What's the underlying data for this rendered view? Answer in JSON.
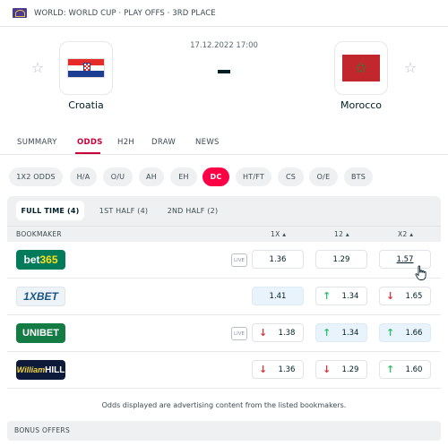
{
  "header": {
    "title": "WORLD: WORLD CUP · PLAY OFFS · 3RD PLACE"
  },
  "match": {
    "datetime": "17.12.2022 17:00",
    "score": "-",
    "home": {
      "name": "Croatia"
    },
    "away": {
      "name": "Morocco"
    }
  },
  "icons": {
    "favorite": "star-icon",
    "arrow_up": "arrow-up-icon",
    "arrow_down": "arrow-down-icon",
    "cursor": "hand-cursor-icon"
  },
  "tabs": [
    "SUMMARY",
    "ODDS",
    "H2H",
    "DRAW",
    "NEWS"
  ],
  "active_tab": "ODDS",
  "markets": [
    "1X2 ODDS",
    "H/A",
    "O/U",
    "AH",
    "EH",
    "DC",
    "HT/FT",
    "CS",
    "O/E",
    "BTS"
  ],
  "active_market": "DC",
  "periods": [
    "FULL TIME (4)",
    "1ST HALF (4)",
    "2ND HALF (2)"
  ],
  "active_period": "FULL TIME (4)",
  "table": {
    "columns": {
      "bookmaker": "BOOKMAKER",
      "c1": "1X ▴",
      "c2": "12 ▴",
      "c3": "X2 ▴"
    },
    "rows": [
      {
        "bookmaker": "bet365",
        "live": "LIVE",
        "odds": [
          "1.36",
          "1.29",
          "1.57"
        ]
      },
      {
        "bookmaker": "1XBET",
        "live": "",
        "odds": [
          "1.41",
          "1.34",
          "1.65"
        ]
      },
      {
        "bookmaker": "UNIBET",
        "live": "LIVE",
        "odds": [
          "1.38",
          "1.34",
          "1.66"
        ]
      },
      {
        "bookmaker": "William HILL",
        "live": "",
        "odds": [
          "1.36",
          "1.29",
          "1.60"
        ]
      }
    ]
  },
  "disclaimer": "Odds displayed are advertising content from the listed bookmakers.",
  "bonus_header": "BONUS OFFERS",
  "colors": {
    "accent": "#ff0046",
    "tab_active": "#c80037",
    "up": "#2dbe6c",
    "down": "#d9323a",
    "highlight": "#e8f3fb"
  }
}
